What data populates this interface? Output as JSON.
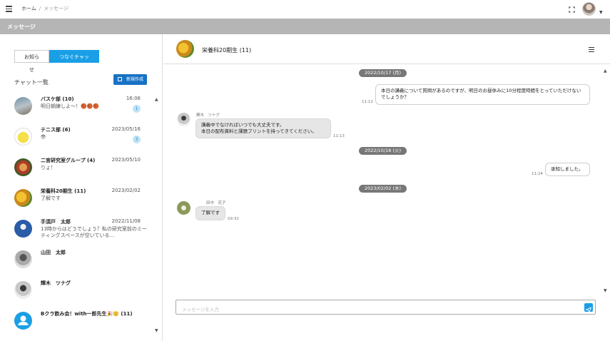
{
  "breadcrumb": {
    "home": "ホーム",
    "separator": "/",
    "current": "メッセージ"
  },
  "header": {
    "title": "メッセージ"
  },
  "tabs": [
    {
      "label": "お知らせ"
    },
    {
      "label": "つなぐチャット"
    }
  ],
  "sidebar": {
    "title": "チャット一覧",
    "new_button": "新規作成",
    "items": [
      {
        "name": "バスケ部 (10)",
        "date": "16:06",
        "preview": "明日朝練しよ〜！🏀🏀🏀",
        "badge": "1"
      },
      {
        "name": "テニス部 (6)",
        "date": "2023/05/16",
        "preview": "😎",
        "badge": "3"
      },
      {
        "name": "二宮研究室グループ (4)",
        "date": "2023/05/10",
        "preview": "りょ！",
        "badge": ""
      },
      {
        "name": "栄養科20期生 (11)",
        "date": "2023/02/02",
        "preview": "了解です",
        "badge": ""
      },
      {
        "name": "手須戸　太郎",
        "date": "2022/11/08",
        "preview": "13時からはどうでしょう？私の研究室前のミーティングスペースが空いている...",
        "badge": ""
      },
      {
        "name": "山田　太郎",
        "date": "",
        "preview": "",
        "badge": ""
      },
      {
        "name": "輝木　ツナグ",
        "date": "",
        "preview": "",
        "badge": ""
      },
      {
        "name": "Bクラ飲み会！with一郎先生🎉🙂 (11)",
        "date": "",
        "preview": "",
        "badge": ""
      }
    ]
  },
  "chat": {
    "title": "栄養科20期生 (11)",
    "dates": [
      "2022/10/17 (月)",
      "2022/10/18 (火)",
      "2023/02/02 (木)"
    ],
    "messages": [
      {
        "text": "本日の講義について質問があるのですが、明日のお昼休みに10分程度時間をとっていただけないでしょうか？",
        "time": "11:12",
        "mine": true
      },
      {
        "sender": "輝木　ツナグ",
        "text": "講義中でなければいつでも大丈夫です。\n本日の配布資料と課題プリントを持ってきてください。",
        "time": "11:13",
        "mine": false
      },
      {
        "text": "承知しました。",
        "time": "11:24",
        "mine": true
      },
      {
        "sender": "田中　花子",
        "text": "了解です",
        "time": "09:32",
        "mine": false
      }
    ],
    "input_placeholder": "メッセージを入力"
  }
}
